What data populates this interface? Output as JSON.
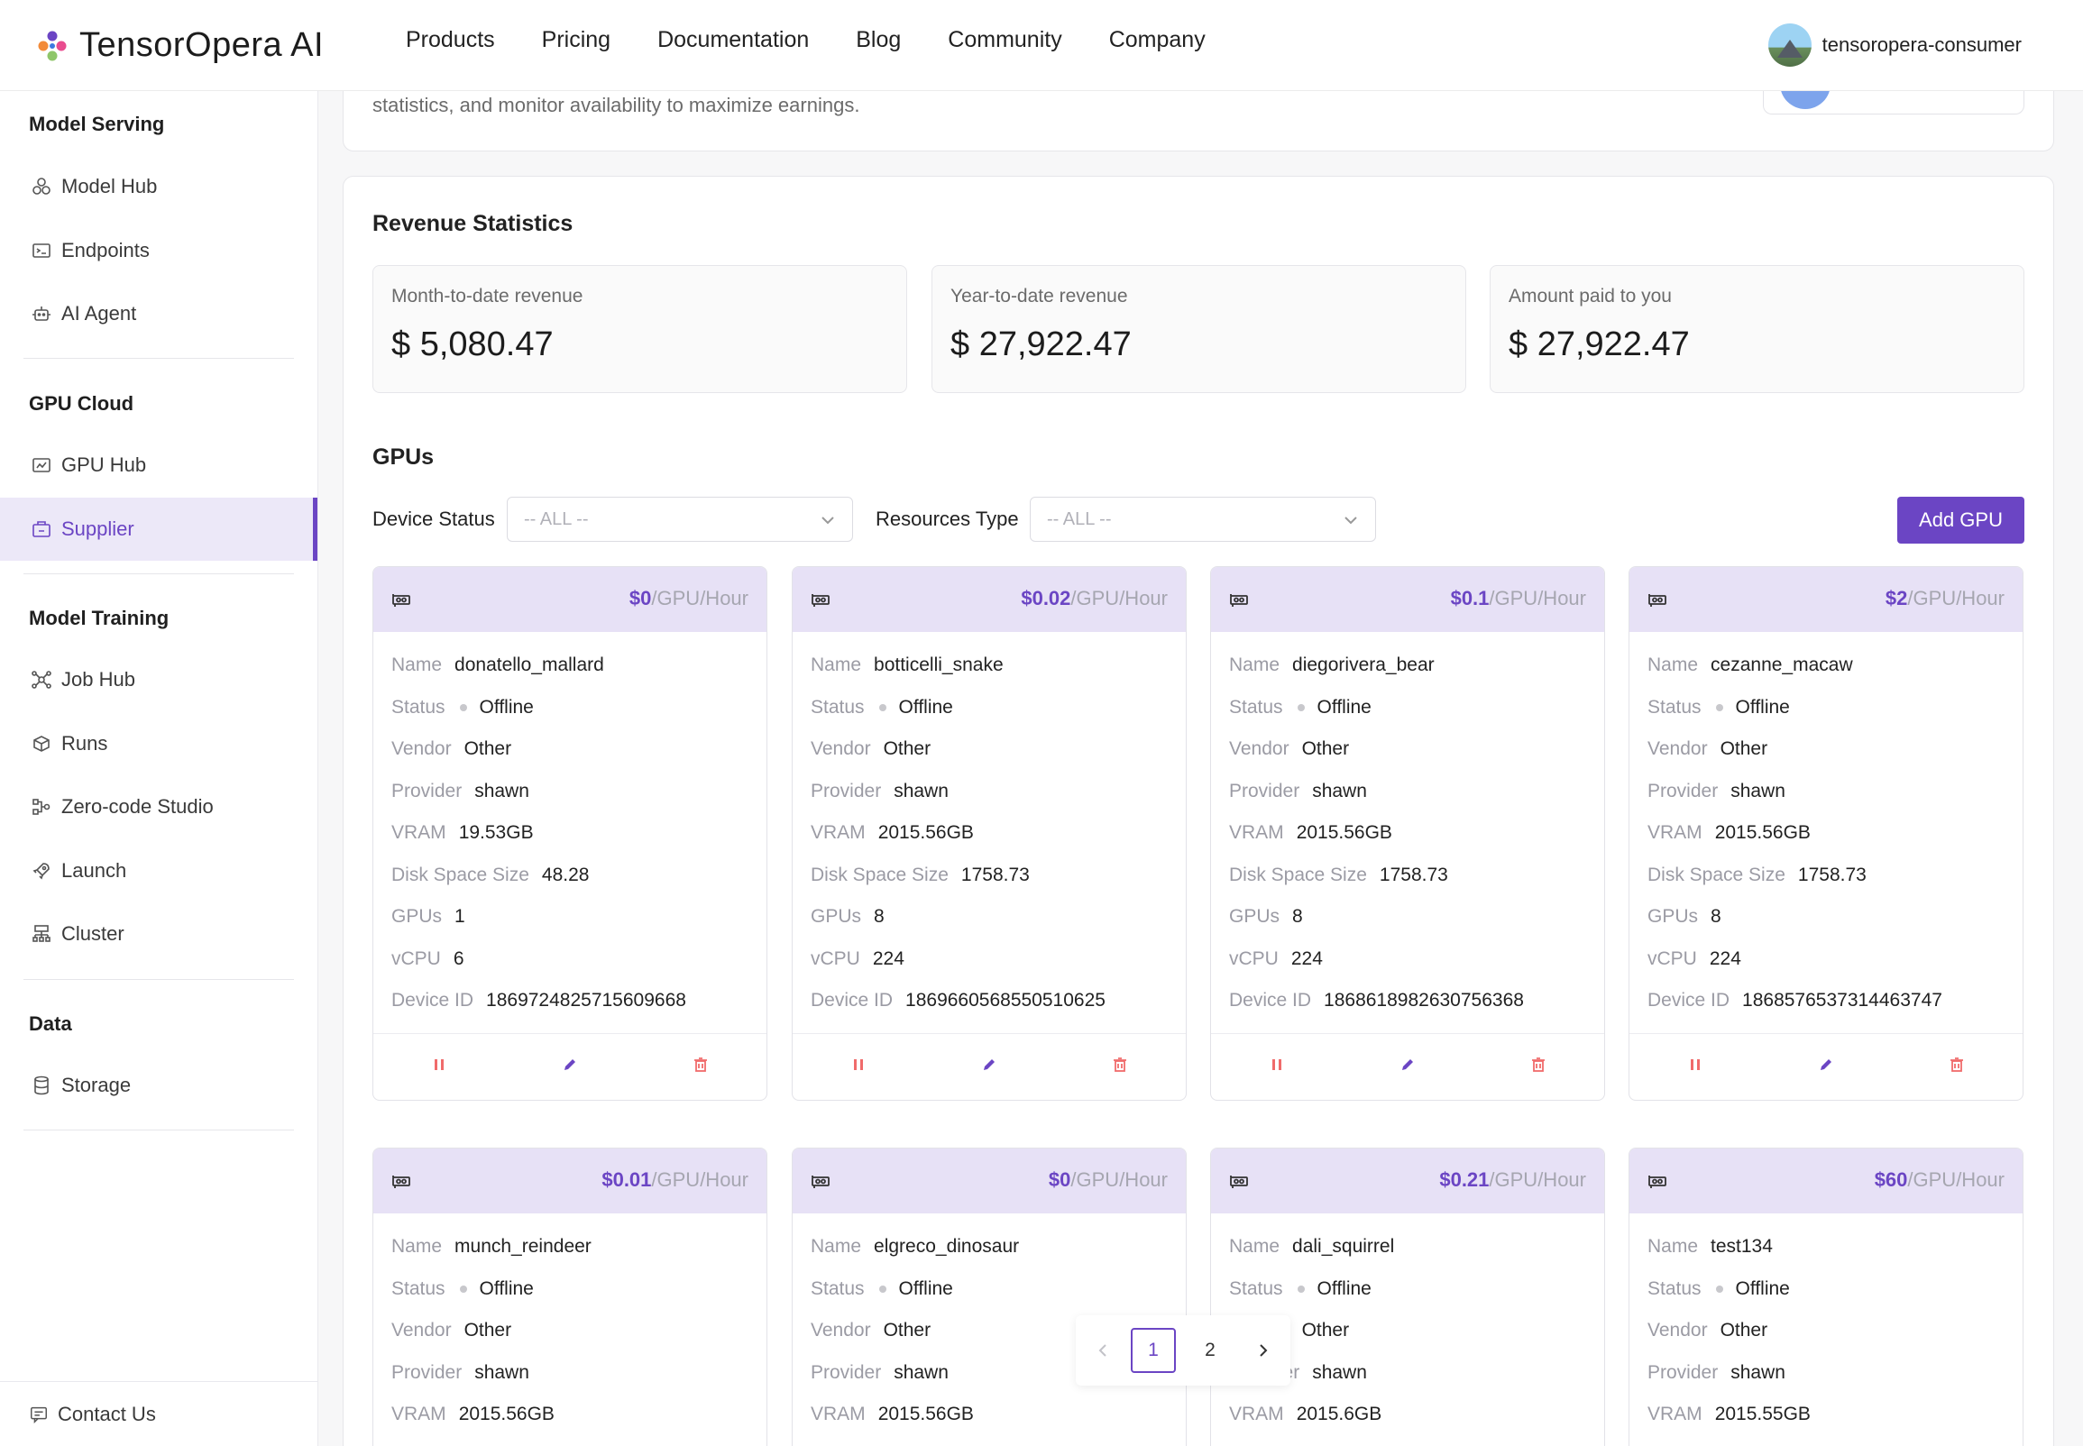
{
  "brand": {
    "name": "TensorOpera AI"
  },
  "nav": [
    "Products",
    "Pricing",
    "Documentation",
    "Blog",
    "Community",
    "Company"
  ],
  "user": {
    "name": "tensoropera-consumer"
  },
  "sidebar": {
    "sections": [
      {
        "title": "Model Serving",
        "items": [
          "Model Hub",
          "Endpoints",
          "AI Agent"
        ]
      },
      {
        "title": "GPU Cloud",
        "items": [
          "GPU Hub",
          "Supplier"
        ]
      },
      {
        "title": "Model Training",
        "items": [
          "Job Hub",
          "Runs",
          "Zero-code Studio",
          "Launch",
          "Cluster"
        ]
      },
      {
        "title": "Data",
        "items": [
          "Storage"
        ]
      }
    ],
    "active": "Supplier",
    "contact": "Contact Us"
  },
  "intro": {
    "text": "statistics, and monitor availability to maximize earnings."
  },
  "revenue": {
    "title": "Revenue Statistics",
    "stats": [
      {
        "label": "Month-to-date revenue",
        "value": "$ 5,080.47"
      },
      {
        "label": "Year-to-date revenue",
        "value": "$ 27,922.47"
      },
      {
        "label": "Amount paid to you",
        "value": "$ 27,922.47"
      }
    ]
  },
  "gpus": {
    "title": "GPUs",
    "filters": {
      "device_status_label": "Device Status",
      "device_status_value": "-- ALL --",
      "resources_type_label": "Resources Type",
      "resources_type_value": "-- ALL --"
    },
    "add_button": "Add GPU",
    "unit": "/GPU/Hour",
    "field_labels": {
      "name": "Name",
      "status": "Status",
      "vendor": "Vendor",
      "provider": "Provider",
      "vram": "VRAM",
      "disk": "Disk Space Size",
      "gpus": "GPUs",
      "vcpu": "vCPU",
      "device_id": "Device ID"
    },
    "cards": [
      {
        "price": "$0",
        "name": "donatello_mallard",
        "status": "Offline",
        "vendor": "Other",
        "provider": "shawn",
        "vram": "19.53GB",
        "disk": "48.28",
        "gpus": "1",
        "vcpu": "6",
        "device_id": "1869724825715609668"
      },
      {
        "price": "$0.02",
        "name": "botticelli_snake",
        "status": "Offline",
        "vendor": "Other",
        "provider": "shawn",
        "vram": "2015.56GB",
        "disk": "1758.73",
        "gpus": "8",
        "vcpu": "224",
        "device_id": "1869660568550510625"
      },
      {
        "price": "$0.1",
        "name": "diegorivera_bear",
        "status": "Offline",
        "vendor": "Other",
        "provider": "shawn",
        "vram": "2015.56GB",
        "disk": "1758.73",
        "gpus": "8",
        "vcpu": "224",
        "device_id": "1868618982630756368"
      },
      {
        "price": "$2",
        "name": "cezanne_macaw",
        "status": "Offline",
        "vendor": "Other",
        "provider": "shawn",
        "vram": "2015.56GB",
        "disk": "1758.73",
        "gpus": "8",
        "vcpu": "224",
        "device_id": "1868576537314463747"
      },
      {
        "price": "$0.01",
        "name": "munch_reindeer",
        "status": "Offline",
        "vendor": "Other",
        "provider": "shawn",
        "vram": "2015.56GB"
      },
      {
        "price": "$0",
        "name": "elgreco_dinosaur",
        "status": "Offline",
        "vendor": "Other",
        "provider": "shawn",
        "vram": "2015.56GB"
      },
      {
        "price": "$0.21",
        "name": "dali_squirrel",
        "status": "Offline",
        "vendor": "Other",
        "provider": "shawn",
        "vram": "2015.6GB"
      },
      {
        "price": "$60",
        "name": "test134",
        "status": "Offline",
        "vendor": "Other",
        "provider": "shawn",
        "vram": "2015.55GB"
      }
    ]
  },
  "pagination": {
    "pages": [
      "1",
      "2"
    ],
    "current": "1"
  },
  "colors": {
    "accent": "#6b45c4",
    "card_header": "#e7e1f6",
    "danger": "#f06b6b"
  },
  "icons": {
    "row_actions": [
      "pause-icon",
      "edit-icon",
      "delete-icon"
    ],
    "gpu_card": "gpu-card-icon"
  }
}
